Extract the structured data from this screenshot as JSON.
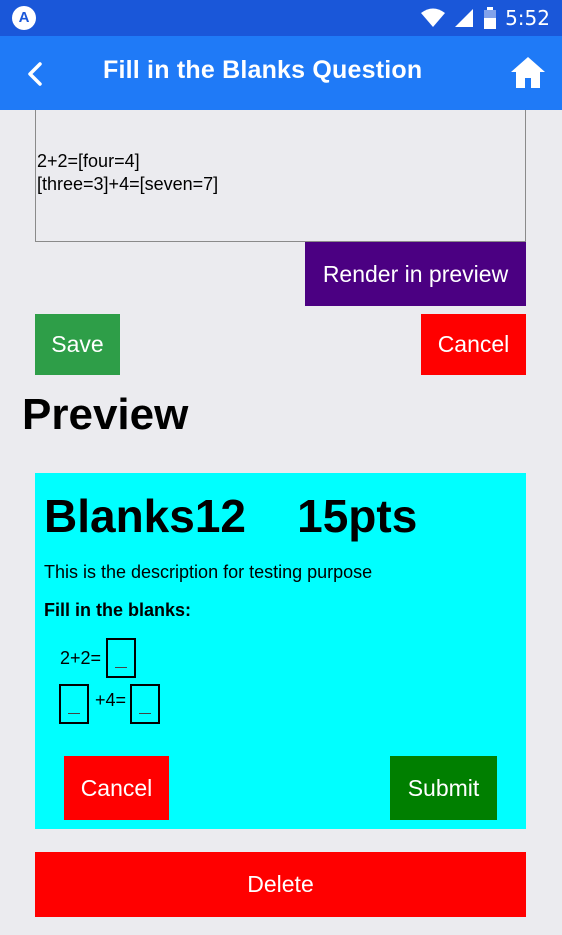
{
  "status_bar": {
    "time": "5:52",
    "app_icon": "A"
  },
  "app_bar": {
    "title": "Fill in the Blanks Question"
  },
  "editor": {
    "line1": "2+2=[four=4]",
    "line2": "[three=3]+4=[seven=7]"
  },
  "buttons": {
    "render_preview": "Render in preview",
    "save": "Save",
    "cancel": "Cancel",
    "delete": "Delete"
  },
  "preview": {
    "heading": "Preview",
    "title": "Blanks12    15pts",
    "description": "This is the description for testing purpose",
    "fill_label": "Fill in the blanks:",
    "eq1_text": "2+2=",
    "eq2_text": "+4=",
    "cancel_label": "Cancel",
    "submit_label": "Submit"
  },
  "colors": {
    "app_bar": "#1f7af7",
    "status_bar": "#1a57d9",
    "render_button": "#4b0082",
    "save_button": "#2e9e48",
    "cancel_button": "#ff0000",
    "submit_button": "#007f00",
    "card_bg": "#00ffff"
  }
}
